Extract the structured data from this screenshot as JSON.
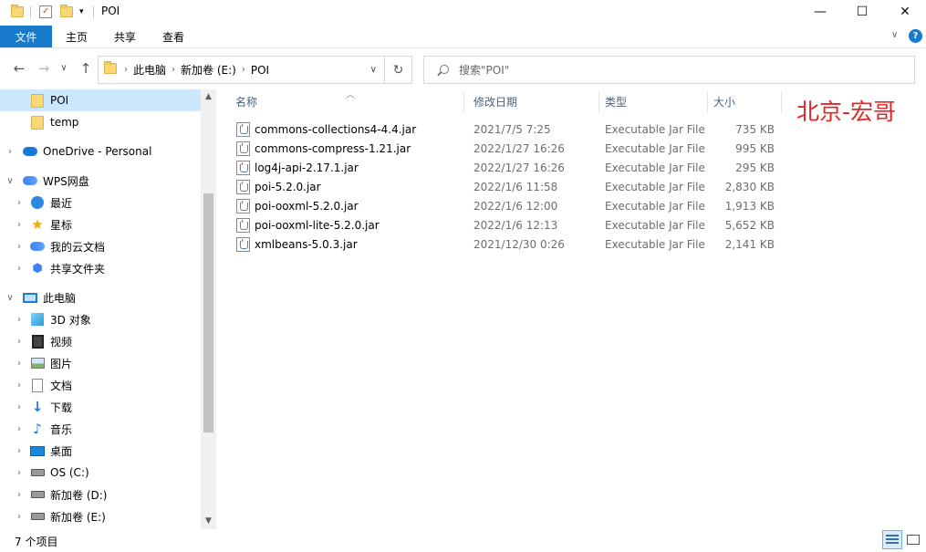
{
  "window": {
    "title": "POI",
    "minimize": "—",
    "maximize": "☐",
    "close": "✕"
  },
  "ribbon": {
    "tabs": [
      "文件",
      "主页",
      "共享",
      "查看"
    ],
    "expand": "∨",
    "help": "?"
  },
  "nav": {
    "back": "←",
    "forward": "→",
    "recent": "∨",
    "up": "↑",
    "breadcrumbs": [
      "此电脑",
      "新加卷 (E:)",
      "POI"
    ],
    "refresh": "↻"
  },
  "search": {
    "placeholder": "搜索\"POI\""
  },
  "sidebar": {
    "items": [
      {
        "label": "POI",
        "icon": "folder-icon",
        "selected": true
      },
      {
        "label": "temp",
        "icon": "folder-icon"
      },
      {
        "label": "OneDrive - Personal",
        "icon": "onedrive-cloud-icon"
      },
      {
        "label": "WPS网盘",
        "icon": "wps-cloud-icon"
      },
      {
        "label": "最近",
        "icon": "clock-icon"
      },
      {
        "label": "星标",
        "icon": "star-icon"
      },
      {
        "label": "我的云文档",
        "icon": "cloud-docs-icon"
      },
      {
        "label": "共享文件夹",
        "icon": "share-folder-icon"
      },
      {
        "label": "此电脑",
        "icon": "computer-icon"
      },
      {
        "label": "3D 对象",
        "icon": "3d-objects-icon"
      },
      {
        "label": "视频",
        "icon": "video-icon"
      },
      {
        "label": "图片",
        "icon": "pictures-icon"
      },
      {
        "label": "文档",
        "icon": "documents-icon"
      },
      {
        "label": "下载",
        "icon": "download-icon"
      },
      {
        "label": "音乐",
        "icon": "music-icon"
      },
      {
        "label": "桌面",
        "icon": "desktop-icon"
      },
      {
        "label": "OS (C:)",
        "icon": "drive-c-icon"
      },
      {
        "label": "新加卷 (D:)",
        "icon": "drive-d-icon"
      },
      {
        "label": "新加卷 (E:)",
        "icon": "drive-e-icon"
      }
    ]
  },
  "columns": {
    "name": "名称",
    "date": "修改日期",
    "type": "类型",
    "size": "大小"
  },
  "files": [
    {
      "name": "commons-collections4-4.4.jar",
      "date": "2021/7/5 7:25",
      "type": "Executable Jar File",
      "size": "735 KB"
    },
    {
      "name": "commons-compress-1.21.jar",
      "date": "2022/1/27 16:26",
      "type": "Executable Jar File",
      "size": "995 KB"
    },
    {
      "name": "log4j-api-2.17.1.jar",
      "date": "2022/1/27 16:26",
      "type": "Executable Jar File",
      "size": "295 KB"
    },
    {
      "name": "poi-5.2.0.jar",
      "date": "2022/1/6 11:58",
      "type": "Executable Jar File",
      "size": "2,830 KB"
    },
    {
      "name": "poi-ooxml-5.2.0.jar",
      "date": "2022/1/6 12:00",
      "type": "Executable Jar File",
      "size": "1,913 KB"
    },
    {
      "name": "poi-ooxml-lite-5.2.0.jar",
      "date": "2022/1/6 12:13",
      "type": "Executable Jar File",
      "size": "5,652 KB"
    },
    {
      "name": "xmlbeans-5.0.3.jar",
      "date": "2021/12/30 0:26",
      "type": "Executable Jar File",
      "size": "2,141 KB"
    }
  ],
  "watermark": "北京-宏哥",
  "status": {
    "count": "7 个项目"
  },
  "colors": {
    "accent": "#1979ca",
    "selection": "#cce8ff",
    "watermark": "#e32727"
  }
}
